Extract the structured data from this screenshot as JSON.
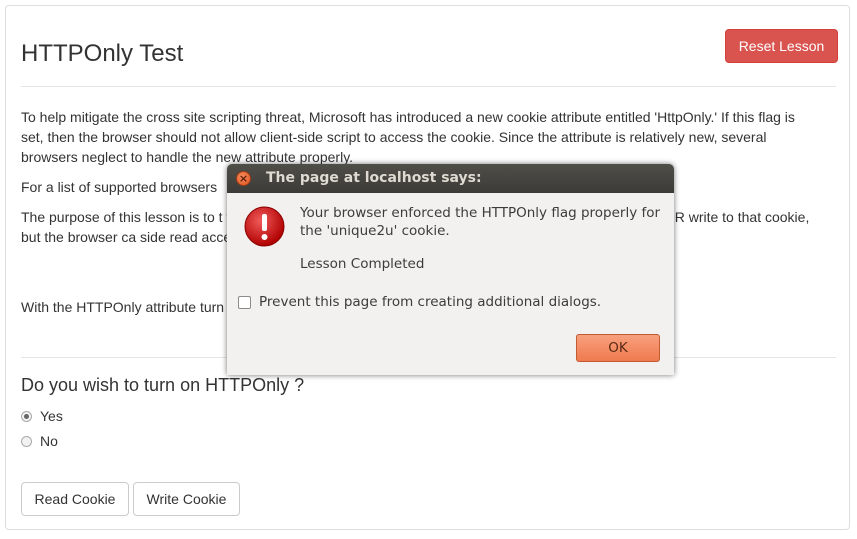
{
  "page": {
    "title": "HTTPOnly Test",
    "reset_label": "Reset Lesson",
    "paragraphs": {
      "intro": "To help mitigate the cross site scripting threat, Microsoft has introduced a new cookie attribute entitled 'HttpOnly.' If this flag is set, then the browser should not allow client-side script to access the cookie. Since the attribute is relatively new, several browsers neglect to handle the new attribute properly.",
      "supported": "For a list of supported browsers",
      "purpose": "The purpose of this lesson is to t                                                                                                    value of the unique2u cookie. If your browser supports                                                                                                    be able to read OR write to that cookie, but the browser ca                                                                                                    side read access, but don't prevent write access.",
      "httponly_on": "With the HTTPOnly attribute turn                                                                                                    bar. Notice all cookies are displayed except the unique2"
    },
    "question": "Do you wish to turn on HTTPOnly ?",
    "options": [
      {
        "label": "Yes",
        "checked": true
      },
      {
        "label": "No",
        "checked": false
      }
    ],
    "read_cookie_label": "Read Cookie",
    "write_cookie_label": "Write Cookie"
  },
  "dialog": {
    "title": "The page at localhost says:",
    "close_glyph": "×",
    "message": "Your browser enforced the HTTPOnly flag properly for the 'unique2u' cookie.",
    "status": "Lesson Completed",
    "checkbox_label": "Prevent this page from creating additional dialogs.",
    "checkbox_checked": false,
    "ok_label": "OK",
    "icon": "error-icon"
  },
  "colors": {
    "danger": "#d9534f",
    "dialog_accent": "#ef7a4e",
    "error_red": "#cc0000"
  }
}
